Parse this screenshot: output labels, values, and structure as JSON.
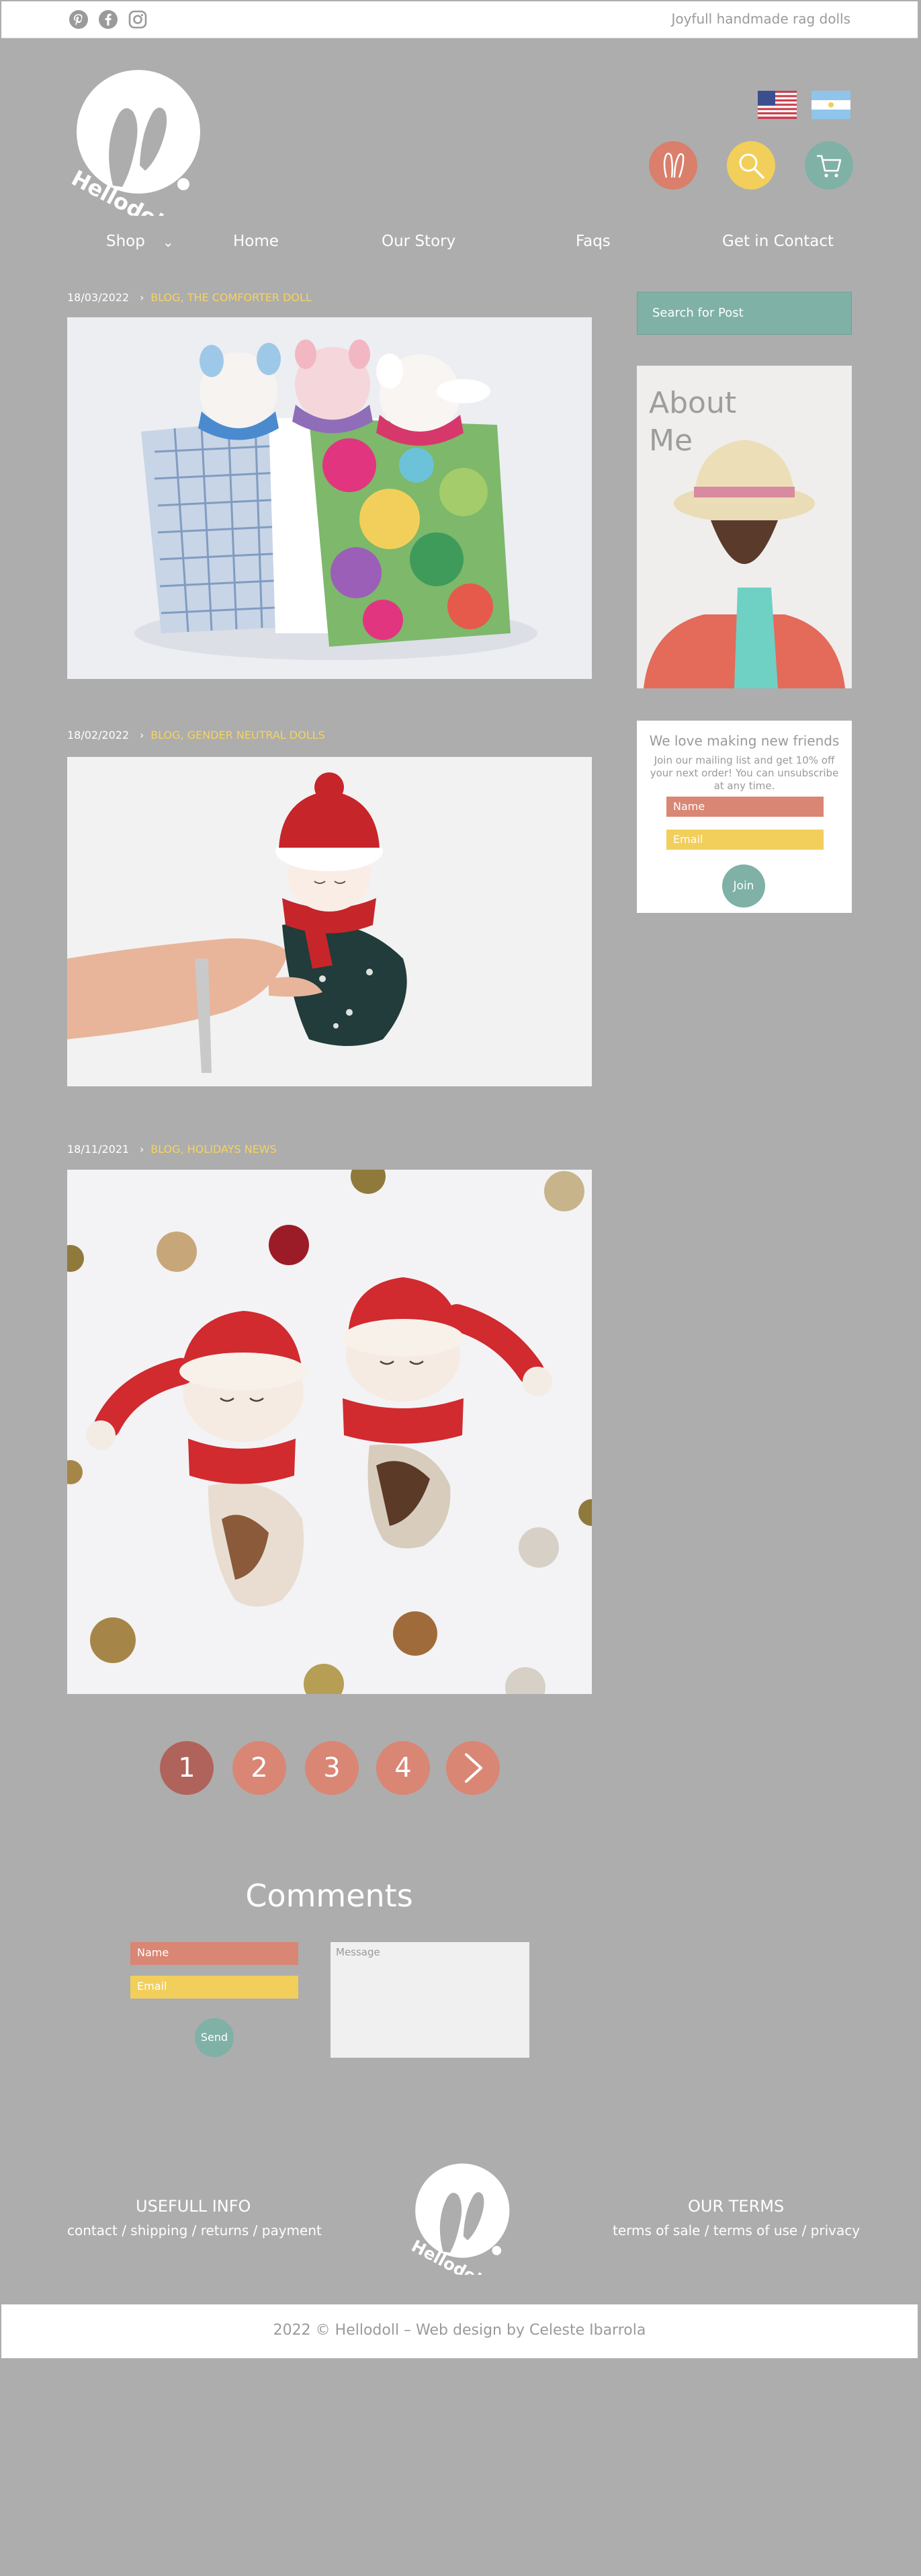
{
  "topbar": {
    "social_icons": [
      "pinterest-icon",
      "facebook-icon",
      "instagram-icon"
    ],
    "tagline": "Joyfull handmade rag dolls"
  },
  "brand": {
    "logo_text": "Hellodoll"
  },
  "header_icons": {
    "flags": [
      "united-states-flag",
      "argentina-flag"
    ],
    "circles": [
      {
        "name": "bunny-icon",
        "color": "#d97f6c"
      },
      {
        "name": "search-icon",
        "color": "#f2cf5b"
      },
      {
        "name": "cart-icon",
        "color": "#7fb1a6"
      }
    ]
  },
  "nav": {
    "shop": "Shop",
    "home": "Home",
    "our_story": "Our Story",
    "faqs": "Faqs",
    "contact": "Get in Contact"
  },
  "posts": [
    {
      "date": "18/03/2022",
      "category": "BLOG, THE COMFORTER DOLL"
    },
    {
      "date": "18/02/2022",
      "category": "BLOG, GENDER NEUTRAL DOLLS"
    },
    {
      "date": "18/11/2021",
      "category": "BLOG, HOLIDAYS NEWS"
    }
  ],
  "sidebar": {
    "search_placeholder": "Search for Post",
    "about_title": "About\nMe",
    "newsletter": {
      "title": "We love making new friends",
      "text": "Join our mailing list and get 10% off your next order! You can unsubscribe at any time.",
      "name_placeholder": "Name",
      "email_placeholder": "Email",
      "join": "Join"
    }
  },
  "pagination": {
    "pages": [
      "1",
      "2",
      "3",
      "4"
    ],
    "active": "1",
    "next_icon": "chevron-right-icon"
  },
  "comments": {
    "title": "Comments",
    "name_placeholder": "Name",
    "email_placeholder": "Email",
    "message_placeholder": "Message",
    "send": "Send"
  },
  "footer": {
    "left_title": "USEFULL INFO",
    "left_links": "contact / shipping / returns / payment",
    "right_title": "OUR TERMS",
    "right_links": "terms of sale / terms of use / privacy",
    "copyright": "2022 © Hellodoll – Web design by Celeste Ibarrola"
  },
  "colors": {
    "background": "#adadad",
    "coral": "#d98674",
    "yellow": "#f2cf5b",
    "teal": "#7fb1a6"
  }
}
